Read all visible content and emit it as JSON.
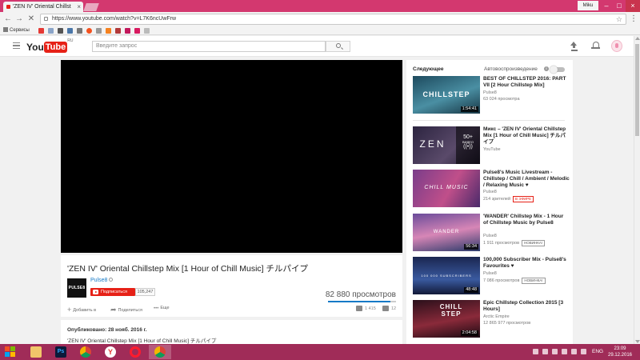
{
  "browser": {
    "tab_title": "'ZEN IV' Oriental Chillst",
    "tab_close": "×",
    "url": "https://www.youtube.com/watch?v=L7K6ncUwFrw",
    "user_chip": "Miku",
    "win_min": "–",
    "win_max": "□",
    "win_close": "×",
    "back": "←",
    "forward": "→",
    "reload": "✕",
    "star": "☆",
    "menu": "⋮",
    "bookmarks_label": "Сервисы"
  },
  "yt": {
    "logo_you": "You",
    "logo_tube": "Tube",
    "logo_region": "RU",
    "search_placeholder": "Введите запрос"
  },
  "video": {
    "title": "'ZEN IV' Oriental Chillstep Mix [1 Hour of Chill Music] チルパイプ",
    "channel": "Pulse8",
    "channel_logo_text": "PULSE8",
    "subscribe_label": "Подписаться",
    "subscribers": "105,247",
    "views": "82 880 просмотров",
    "like_ratio": 0.92,
    "actions": {
      "add": "Добавить в",
      "share": "Поделиться",
      "more": "Еще",
      "add_icon": "+",
      "share_icon": "➦",
      "more_icon": "•••"
    },
    "likes": "1 415",
    "dislikes": "12",
    "published": "Опубликовано: 28 нояб. 2016 г.",
    "description": "'ZEN IV' Oriental Chillstep Mix [1 Hour of Chill Music] チルパイプ"
  },
  "sidebar": {
    "next_label": "Следующее",
    "autoplay_label": "Автовоспроизведение",
    "autoplay_info": "i",
    "recommendations": [
      {
        "title": "BEST OF CHILLSTEP 2016: PART VII [2 Hour Chillstep Mix]",
        "channel": "Pulse8",
        "stats": "63 024 просмотра",
        "duration": "1:54:41",
        "thumb_text": "CHILLSTEP",
        "badge": ""
      },
      {
        "title": "Микс – 'ZEN IV' Oriental Chillstep Mix [1 Hour of Chill Music] チルパイプ",
        "channel": "YouTube",
        "stats": "",
        "duration": "",
        "thumb_text": "ZEN",
        "mix_count": "50+",
        "mix_label": "ВИДЕО",
        "badge": ""
      },
      {
        "title": "Pulse8's Music Livestream - Chillstep / Chill / Ambient / Melodic / Relaxing Music ♥",
        "channel": "Pulse8",
        "stats": "214 зрителей",
        "duration": "",
        "thumb_text": "CHILL MUSIC",
        "badge": "В ЭФИРЕ"
      },
      {
        "title": "'WANDER' Chillstep Mix - 1 Hour of Chillstep Music by Pulse8",
        "channel": "Pulse8",
        "stats": "1 911 просмотров",
        "duration": "56:34",
        "thumb_text": "WANDER",
        "badge": "НОВИНКА!"
      },
      {
        "title": "100,000 Subscriber Mix - Pulse8's Favourites ♥",
        "channel": "Pulse8",
        "stats": "7 086 просмотров",
        "duration": "48:48",
        "thumb_text": "100 000 SUBSCRIBERS",
        "badge": "НОВИНКА!"
      },
      {
        "title": "Epic Chillstep Collection 2015 [3 Hours]",
        "channel": "Arctic Empire",
        "stats": "12 865 977 просмотров",
        "duration": "2:04:58",
        "thumb_text": "CHILL STEP",
        "badge": ""
      }
    ]
  },
  "taskbar": {
    "lang": "ENG",
    "time": "23:09",
    "date": "29.12.2016"
  },
  "colors": {
    "titlebar": "#d3386f",
    "taskbar": "#a02c58",
    "youtube_red": "#e62117",
    "link_blue": "#167ac6"
  }
}
